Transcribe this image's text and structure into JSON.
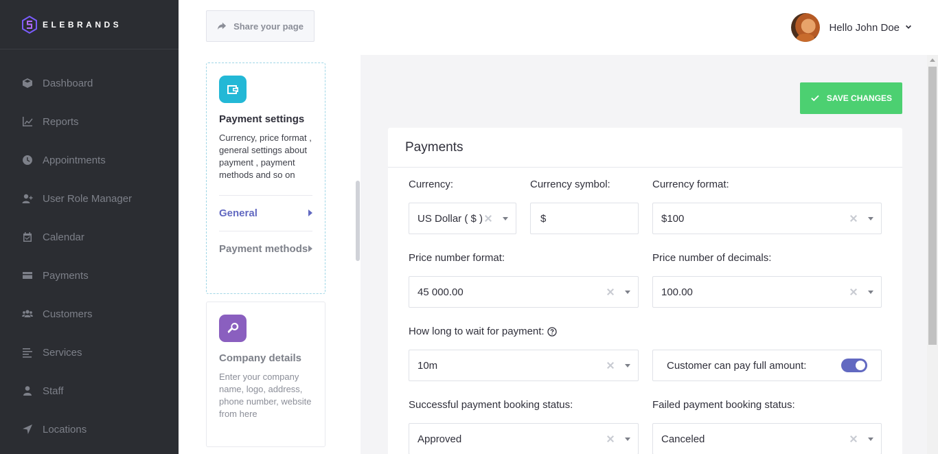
{
  "brand": {
    "name": "ELEBRANDS"
  },
  "sidebar": {
    "items": [
      {
        "label": "Dashboard",
        "icon": "cube-icon"
      },
      {
        "label": "Reports",
        "icon": "chart-line-icon"
      },
      {
        "label": "Appointments",
        "icon": "clock-icon"
      },
      {
        "label": "User Role Manager",
        "icon": "user-plus-icon"
      },
      {
        "label": "Calendar",
        "icon": "calendar-icon"
      },
      {
        "label": "Payments",
        "icon": "wallet-icon"
      },
      {
        "label": "Customers",
        "icon": "users-icon"
      },
      {
        "label": "Services",
        "icon": "list-icon"
      },
      {
        "label": "Staff",
        "icon": "user-icon"
      },
      {
        "label": "Locations",
        "icon": "location-arrow-icon"
      }
    ]
  },
  "header": {
    "share_label": "Share your page",
    "greeting": "Hello John Doe"
  },
  "settings_cards": {
    "payment": {
      "title": "Payment settings",
      "description": "Currency, price format , general settings about payment , payment methods and so on",
      "links": [
        "General",
        "Payment methods"
      ],
      "icon_color": "#23b8d6"
    },
    "company": {
      "title": "Company details",
      "description": "Enter your company name, logo, address, phone number, website from here",
      "icon_color": "#8a5fbf"
    }
  },
  "main": {
    "save_label": "SAVE CHANGES",
    "panel_title": "Payments",
    "fields": {
      "currency": {
        "label": "Currency:",
        "value": "US Dollar ( $ )"
      },
      "currency_symbol": {
        "label": "Currency symbol:",
        "value": "$"
      },
      "currency_format": {
        "label": "Currency format:",
        "value": "$100"
      },
      "price_number_format": {
        "label": "Price number format:",
        "value": "45 000.00"
      },
      "price_decimals": {
        "label": "Price number of decimals:",
        "value": "100.00"
      },
      "wait_for_payment": {
        "label": "How long to wait for payment:",
        "value": "10m"
      },
      "pay_full_amount": {
        "label": "Customer can pay full amount:",
        "enabled": true
      },
      "success_status": {
        "label": "Successful payment booking status:",
        "value": "Approved"
      },
      "failed_status": {
        "label": "Failed payment booking status:",
        "value": "Canceled"
      }
    }
  },
  "colors": {
    "sidebar_bg": "#2b2d32",
    "accent": "#6269c1",
    "save_green": "#4cd071"
  }
}
